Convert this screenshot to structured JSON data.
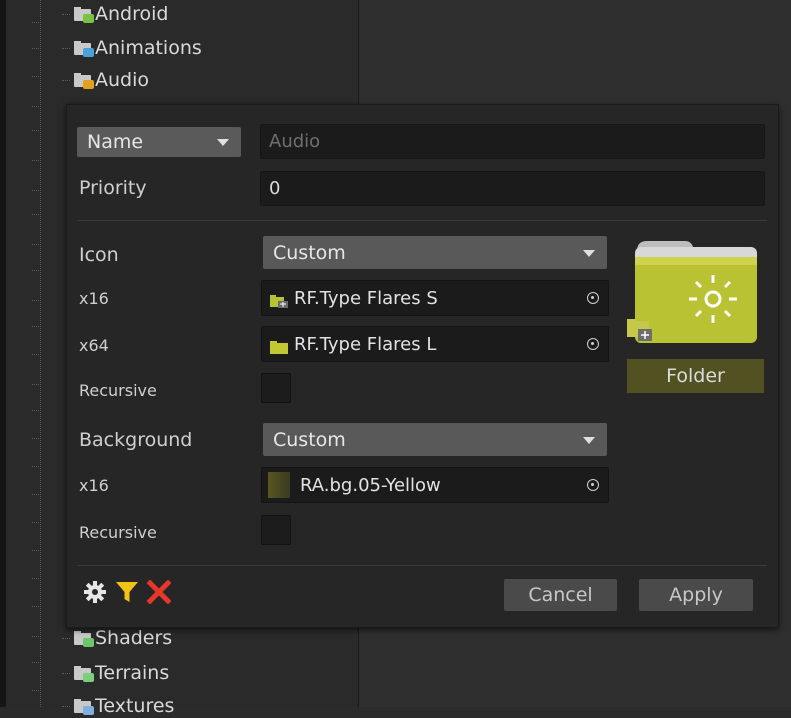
{
  "tree": {
    "items_top": [
      {
        "label": "Android",
        "badge": "#7cc242"
      },
      {
        "label": "Animations",
        "badge": "#4aa3d8"
      },
      {
        "label": "Audio",
        "badge": "#e0a020"
      }
    ],
    "items_bottom": [
      {
        "label": "Shaders",
        "badge": "#6cc76c"
      },
      {
        "label": "Terrains",
        "badge": "#7ad07a"
      },
      {
        "label": "Textures",
        "badge": "#7fb0e0"
      }
    ]
  },
  "editor": {
    "name_dropdown": "Name",
    "name_placeholder": "Audio",
    "priority_label": "Priority",
    "priority_value": "0",
    "icon_label": "Icon",
    "icon_mode": "Custom",
    "x16_label": "x16",
    "x16_value": "RF.Type Flares S",
    "x64_label": "x64",
    "x64_value": "RF.Type Flares L",
    "recursive_label": "Recursive",
    "background_label": "Background",
    "background_mode": "Custom",
    "bg_x16_label": "x16",
    "bg_x16_value": "RA.bg.05-Yellow",
    "bg_recursive_label": "Recursive",
    "preview_label": "Folder",
    "cancel_label": "Cancel",
    "apply_label": "Apply"
  },
  "colors": {
    "folder_yellow": "#b9c232",
    "accent_filter": "#f2c316",
    "accent_delete": "#e5372b"
  }
}
